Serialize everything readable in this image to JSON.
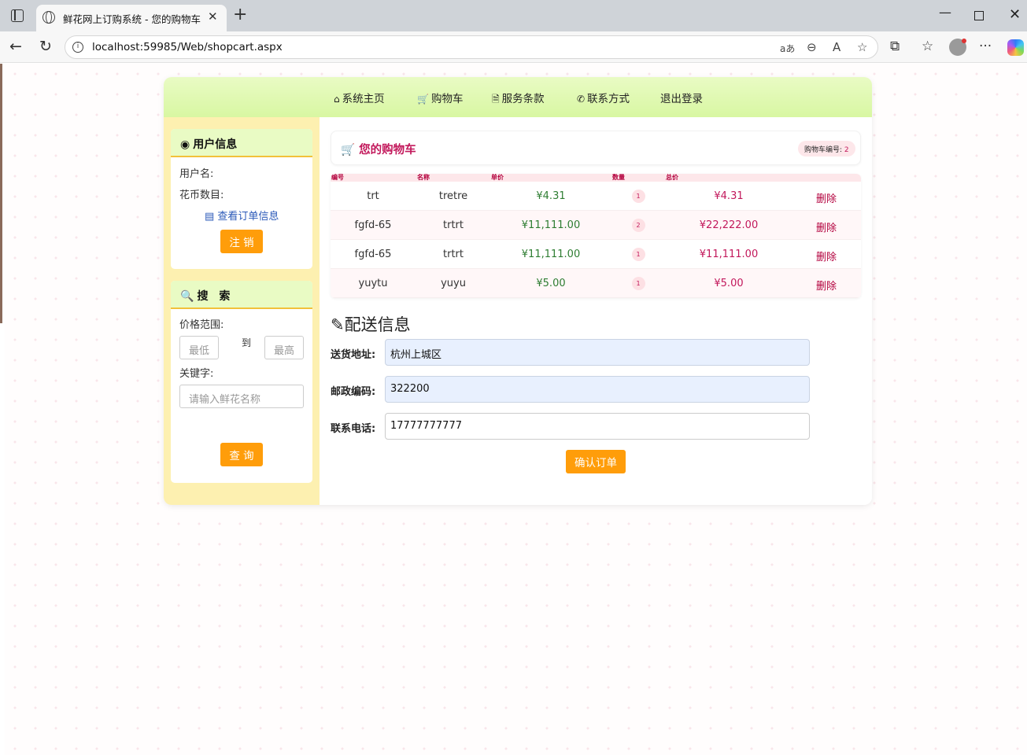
{
  "browser": {
    "tab_title": "鲜花网上订购系统 - 您的购物车",
    "url": "localhost:59985/Web/shopcart.aspx",
    "read_aloud_label": "aあ"
  },
  "nav": {
    "items": [
      {
        "icon": "home-icon",
        "glyph": "⌂",
        "label": "系统主页"
      },
      {
        "icon": "cart-icon",
        "glyph": "🛒",
        "label": "购物车"
      },
      {
        "icon": "document-icon",
        "glyph": "🗎",
        "label": "服务条款"
      },
      {
        "icon": "phone-icon",
        "glyph": "✆",
        "label": "联系方式"
      },
      {
        "icon": "",
        "glyph": "",
        "label": "退出登录"
      }
    ]
  },
  "user_panel": {
    "title": "用户信息",
    "username_label": "用户名:",
    "coins_label": "花币数目:",
    "orders_link": "查看订单信息",
    "logout_button": "注 销"
  },
  "search_panel": {
    "title": "搜　索",
    "price_range_label": "价格范围:",
    "min_placeholder": "最低",
    "to_label": "到",
    "max_placeholder": "最高",
    "keyword_label": "关键字:",
    "keyword_placeholder": "请输入鲜花名称",
    "search_button": "查 询"
  },
  "cart": {
    "title": "您的购物车",
    "badge_label": "购物车编号:",
    "badge_value": "2",
    "columns": [
      "编号",
      "名称",
      "单价",
      "数量",
      "总价"
    ],
    "rows": [
      {
        "id": "trt",
        "name": "tretre",
        "price": "¥4.31",
        "qty": "1",
        "total": "¥4.31",
        "action": "删除"
      },
      {
        "id": "fgfd-65",
        "name": "trtrt",
        "price": "¥11,111.00",
        "qty": "2",
        "total": "¥22,222.00",
        "action": "删除"
      },
      {
        "id": "fgfd-65",
        "name": "trtrt",
        "price": "¥11,111.00",
        "qty": "1",
        "total": "¥11,111.00",
        "action": "删除"
      },
      {
        "id": "yuytu",
        "name": "yuyu",
        "price": "¥5.00",
        "qty": "1",
        "total": "¥5.00",
        "action": "删除"
      }
    ]
  },
  "shipping": {
    "title": "配送信息",
    "address_label": "送货地址:",
    "address_value": "杭州上城区",
    "postcode_label": "邮政编码:",
    "postcode_value": "322200",
    "phone_label": "联系电话:",
    "phone_value": "17777777777",
    "confirm_button": "确认订单"
  }
}
